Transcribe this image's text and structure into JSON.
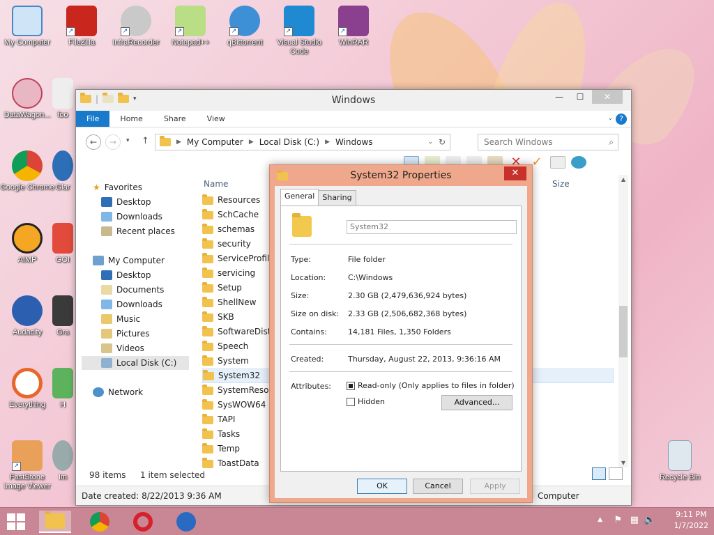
{
  "desktop": {
    "icons": [
      {
        "label": "My Computer"
      },
      {
        "label": "FileZilla"
      },
      {
        "label": "InfraRecorder"
      },
      {
        "label": "Notepad++"
      },
      {
        "label": "qBittorrent"
      },
      {
        "label": "Visual Studio Code"
      },
      {
        "label": "WinRAR"
      },
      {
        "label": "DataWagon..."
      },
      {
        "label": "foo"
      },
      {
        "label": "Google Chrome"
      },
      {
        "label": "Glar"
      },
      {
        "label": "AIMP"
      },
      {
        "label": "GOI"
      },
      {
        "label": "Audacity"
      },
      {
        "label": "Gra"
      },
      {
        "label": "Everything"
      },
      {
        "label": "H"
      },
      {
        "label": "FastStone Image Viewer"
      },
      {
        "label": "Im"
      },
      {
        "label": "Recycle Bin"
      }
    ]
  },
  "explorer": {
    "title": "Windows",
    "ribbon_tabs": [
      "File",
      "Home",
      "Share",
      "View"
    ],
    "address": {
      "segments": [
        "My Computer",
        "Local Disk (C:)",
        "Windows"
      ]
    },
    "search_placeholder": "Search Windows",
    "columns": {
      "name": "Name",
      "size": "Size"
    },
    "nav": {
      "favorites": "Favorites",
      "fav_items": [
        "Desktop",
        "Downloads",
        "Recent places"
      ],
      "computer": "My Computer",
      "computer_items": [
        "Desktop",
        "Documents",
        "Downloads",
        "Music",
        "Pictures",
        "Videos",
        "Local Disk (C:)"
      ],
      "network": "Network"
    },
    "files": [
      "Resources",
      "SchCache",
      "schemas",
      "security",
      "ServiceProfiles",
      "servicing",
      "Setup",
      "ShellNew",
      "SKB",
      "SoftwareDistribution",
      "Speech",
      "System",
      "System32",
      "SystemResources",
      "SysWOW64",
      "TAPI",
      "Tasks",
      "Temp",
      "ToastData"
    ],
    "status": {
      "count": "98 items",
      "selected": "1 item selected"
    },
    "details": {
      "date_created": "Date created: 8/22/2013 9:36 AM",
      "location": "Computer"
    }
  },
  "dialog": {
    "title": "System32 Properties",
    "tabs": [
      "General",
      "Sharing"
    ],
    "name_value": "System32",
    "props": {
      "type_label": "Type:",
      "type_value": "File folder",
      "location_label": "Location:",
      "location_value": "C:\\Windows",
      "size_label": "Size:",
      "size_value": "2.30 GB (2,479,636,924 bytes)",
      "size_on_disk_label": "Size on disk:",
      "size_on_disk_value": "2.33 GB (2,506,682,368 bytes)",
      "contains_label": "Contains:",
      "contains_value": "14,181 Files, 1,350 Folders",
      "created_label": "Created:",
      "created_value": "Thursday, August 22, 2013, 9:36:16 AM",
      "attributes_label": "Attributes:"
    },
    "readonly_label": "Read-only (Only applies to files in folder)",
    "hidden_label": "Hidden",
    "advanced_label": "Advanced...",
    "ok_label": "OK",
    "cancel_label": "Cancel",
    "apply_label": "Apply"
  },
  "taskbar": {
    "time": "9:11 PM",
    "date": "1/7/2022"
  },
  "colors": {
    "accent": "#1979ca",
    "dialog_frame": "#f0a88c",
    "taskbar": "#c98795",
    "close_red": "#c7302b"
  }
}
